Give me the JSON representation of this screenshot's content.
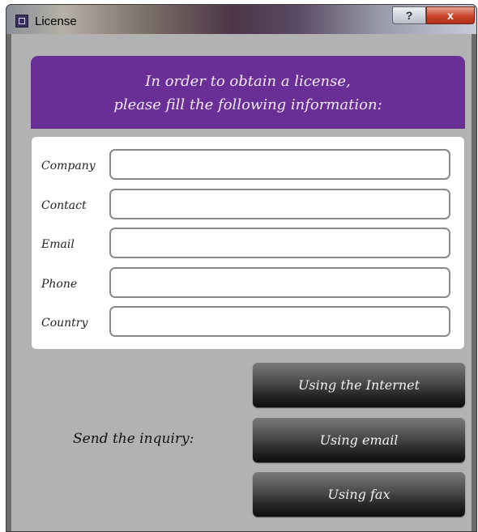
{
  "window": {
    "title": "License",
    "help_button": "?",
    "close_button": "x"
  },
  "header": {
    "line1": "In order to obtain a license,",
    "line2": "please fill the following information:"
  },
  "form": {
    "fields": [
      {
        "label": "Company",
        "value": ""
      },
      {
        "label": "Contact",
        "value": ""
      },
      {
        "label": "Email",
        "value": ""
      },
      {
        "label": "Phone",
        "value": ""
      },
      {
        "label": "Country",
        "value": ""
      }
    ]
  },
  "inquiry": {
    "label": "Send the inquiry:",
    "buttons": [
      "Using the Internet",
      "Using email",
      "Using fax"
    ]
  },
  "colors": {
    "header_bg": "#6a2f96",
    "panel_bg": "#b2b2b2",
    "button_bg": "#2a2a2a"
  },
  "icons": {
    "app": "app-icon",
    "help": "help-icon",
    "close": "close-icon"
  }
}
